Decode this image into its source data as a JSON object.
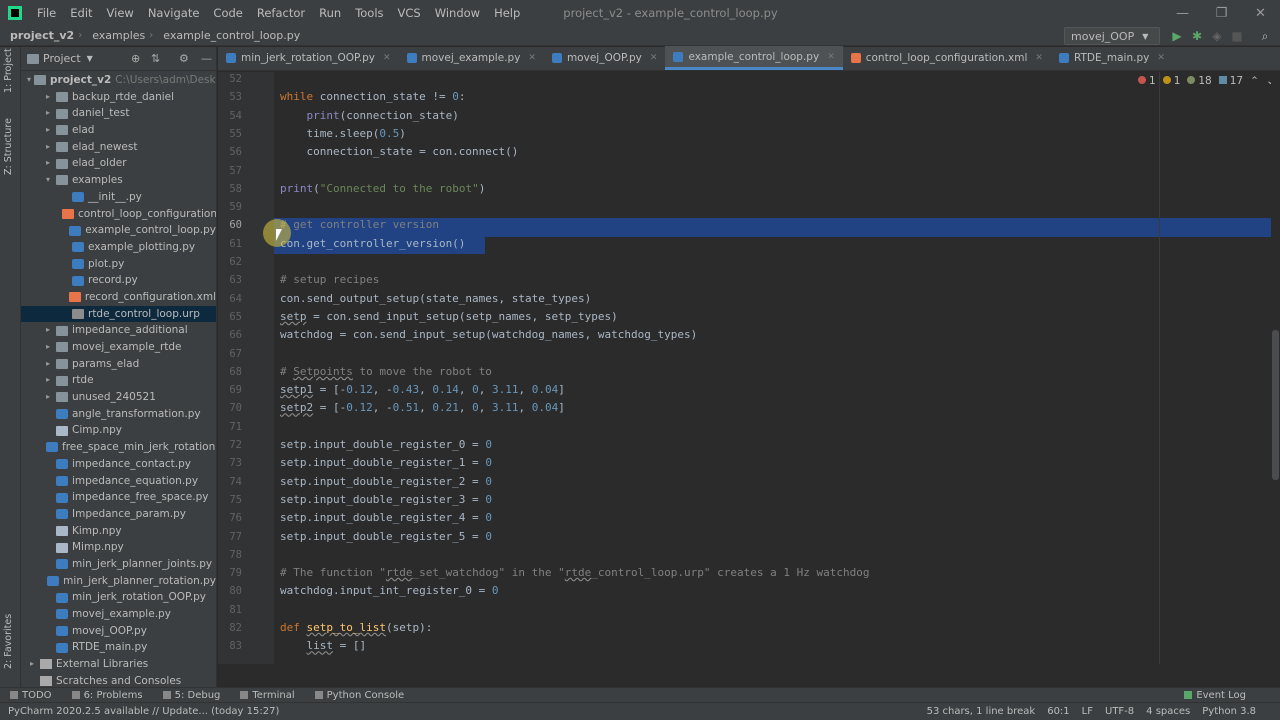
{
  "window": {
    "title": "project_v2 - example_control_loop.py",
    "menu": [
      "File",
      "Edit",
      "View",
      "Navigate",
      "Code",
      "Refactor",
      "Run",
      "Tools",
      "VCS",
      "Window",
      "Help"
    ],
    "controls": [
      "—",
      "❐",
      "✕"
    ]
  },
  "navbar": {
    "crumbs": [
      "project_v2",
      "examples",
      "example_control_loop.py"
    ],
    "run_config": "movej_OOP"
  },
  "left_stripe": {
    "project": "1: Project",
    "structure": "Z: Structure",
    "favorites": "2: Favorites"
  },
  "project_panel": {
    "title": "Project",
    "tree": [
      {
        "label": "project_v2",
        "extra": "C:\\Users\\adm\\Desktop\\p",
        "indent": 0,
        "type": "folder",
        "arrow": "▾",
        "bold": true
      },
      {
        "label": "backup_rtde_daniel",
        "indent": 1,
        "type": "folder",
        "arrow": "▸"
      },
      {
        "label": "daniel_test",
        "indent": 1,
        "type": "folder",
        "arrow": "▸"
      },
      {
        "label": "elad",
        "indent": 1,
        "type": "folder",
        "arrow": "▸"
      },
      {
        "label": "elad_newest",
        "indent": 1,
        "type": "folder",
        "arrow": "▸"
      },
      {
        "label": "elad_older",
        "indent": 1,
        "type": "folder",
        "arrow": "▸"
      },
      {
        "label": "examples",
        "indent": 1,
        "type": "folder",
        "arrow": "▾"
      },
      {
        "label": "__init__.py",
        "indent": 2,
        "type": "py",
        "arrow": ""
      },
      {
        "label": "control_loop_configuration.xml",
        "indent": 2,
        "type": "xml",
        "arrow": ""
      },
      {
        "label": "example_control_loop.py",
        "indent": 2,
        "type": "py",
        "arrow": ""
      },
      {
        "label": "example_plotting.py",
        "indent": 2,
        "type": "py",
        "arrow": ""
      },
      {
        "label": "plot.py",
        "indent": 2,
        "type": "py",
        "arrow": ""
      },
      {
        "label": "record.py",
        "indent": 2,
        "type": "py",
        "arrow": ""
      },
      {
        "label": "record_configuration.xml",
        "indent": 2,
        "type": "xml",
        "arrow": ""
      },
      {
        "label": "rtde_control_loop.urp",
        "indent": 2,
        "type": "urp",
        "arrow": "",
        "selected": true
      },
      {
        "label": "impedance_additional",
        "indent": 1,
        "type": "folder",
        "arrow": "▸"
      },
      {
        "label": "movej_example_rtde",
        "indent": 1,
        "type": "folder",
        "arrow": "▸"
      },
      {
        "label": "params_elad",
        "indent": 1,
        "type": "folder",
        "arrow": "▸"
      },
      {
        "label": "rtde",
        "indent": 1,
        "type": "folder",
        "arrow": "▸"
      },
      {
        "label": "unused_240521",
        "indent": 1,
        "type": "folder",
        "arrow": "▸"
      },
      {
        "label": "angle_transformation.py",
        "indent": 1,
        "type": "py",
        "arrow": ""
      },
      {
        "label": "Cimp.npy",
        "indent": 1,
        "type": "npy",
        "arrow": ""
      },
      {
        "label": "free_space_min_jerk_rotation.py",
        "indent": 1,
        "type": "py",
        "arrow": ""
      },
      {
        "label": "impedance_contact.py",
        "indent": 1,
        "type": "py",
        "arrow": ""
      },
      {
        "label": "impedance_equation.py",
        "indent": 1,
        "type": "py",
        "arrow": ""
      },
      {
        "label": "impedance_free_space.py",
        "indent": 1,
        "type": "py",
        "arrow": ""
      },
      {
        "label": "Impedance_param.py",
        "indent": 1,
        "type": "py",
        "arrow": ""
      },
      {
        "label": "Kimp.npy",
        "indent": 1,
        "type": "npy",
        "arrow": ""
      },
      {
        "label": "Mimp.npy",
        "indent": 1,
        "type": "npy",
        "arrow": ""
      },
      {
        "label": "min_jerk_planner_joints.py",
        "indent": 1,
        "type": "py",
        "arrow": ""
      },
      {
        "label": "min_jerk_planner_rotation.py",
        "indent": 1,
        "type": "py",
        "arrow": ""
      },
      {
        "label": "min_jerk_rotation_OOP.py",
        "indent": 1,
        "type": "py",
        "arrow": ""
      },
      {
        "label": "movej_example.py",
        "indent": 1,
        "type": "py",
        "arrow": ""
      },
      {
        "label": "movej_OOP.py",
        "indent": 1,
        "type": "py",
        "arrow": ""
      },
      {
        "label": "RTDE_main.py",
        "indent": 1,
        "type": "py",
        "arrow": ""
      },
      {
        "label": "External Libraries",
        "indent": 0,
        "type": "lib",
        "arrow": "▸"
      },
      {
        "label": "Scratches and Consoles",
        "indent": 0,
        "type": "lib",
        "arrow": ""
      }
    ]
  },
  "editor_tabs": [
    {
      "label": "min_jerk_rotation_OOP.py",
      "type": "py"
    },
    {
      "label": "movej_example.py",
      "type": "py"
    },
    {
      "label": "movej_OOP.py",
      "type": "py"
    },
    {
      "label": "example_control_loop.py",
      "type": "py",
      "active": true
    },
    {
      "label": "control_loop_configuration.xml",
      "type": "xml"
    },
    {
      "label": "RTDE_main.py",
      "type": "py"
    }
  ],
  "inspections": {
    "errors": "1",
    "warnings": "1",
    "weak": "18",
    "typos": "17"
  },
  "code": {
    "lines": [
      {
        "n": "52",
        "html": ""
      },
      {
        "n": "53",
        "html": "<span class='kw'>while</span> connection_state != <span class='num'>0</span>:"
      },
      {
        "n": "54",
        "html": "    <span class='builtin'>print</span>(connection_state)"
      },
      {
        "n": "55",
        "html": "    time.sleep(<span class='num'>0.5</span>)"
      },
      {
        "n": "56",
        "html": "    connection_state = con.connect()"
      },
      {
        "n": "57",
        "html": ""
      },
      {
        "n": "58",
        "html": "<span class='builtin'>print</span>(<span class='str'>\"Connected to the robot\"</span>)"
      },
      {
        "n": "59",
        "html": ""
      },
      {
        "n": "60",
        "html": "<span class='cmt'># get controller version</span>"
      },
      {
        "n": "61",
        "html": "con.get_controller_version()"
      },
      {
        "n": "62",
        "html": ""
      },
      {
        "n": "63",
        "html": "<span class='cmt'># setup recipes</span>"
      },
      {
        "n": "64",
        "html": "con.send_output_setup(state_names, state_types)"
      },
      {
        "n": "65",
        "html": "<span class='warn-underline'>setp</span> = con.send_input_setup(setp_names, setp_types)"
      },
      {
        "n": "66",
        "html": "watchdog = con.send_input_setup(watchdog_names, watchdog_types)"
      },
      {
        "n": "67",
        "html": ""
      },
      {
        "n": "68",
        "html": "<span class='cmt'># <span class='warn-underline'>Setpoints</span> to move the robot to</span>"
      },
      {
        "n": "69",
        "html": "<span class='warn-underline'>setp1</span> = [-<span class='num'>0.12</span>, -<span class='num'>0.43</span>, <span class='num'>0.14</span>, <span class='num'>0</span>, <span class='num'>3.11</span>, <span class='num'>0.04</span>]"
      },
      {
        "n": "70",
        "html": "<span class='warn-underline'>setp2</span> = [-<span class='num'>0.12</span>, -<span class='num'>0.51</span>, <span class='num'>0.21</span>, <span class='num'>0</span>, <span class='num'>3.11</span>, <span class='num'>0.04</span>]"
      },
      {
        "n": "71",
        "html": ""
      },
      {
        "n": "72",
        "html": "setp.input_double_register_0 = <span class='num'>0</span>"
      },
      {
        "n": "73",
        "html": "setp.input_double_register_1 = <span class='num'>0</span>"
      },
      {
        "n": "74",
        "html": "setp.input_double_register_2 = <span class='num'>0</span>"
      },
      {
        "n": "75",
        "html": "setp.input_double_register_3 = <span class='num'>0</span>"
      },
      {
        "n": "76",
        "html": "setp.input_double_register_4 = <span class='num'>0</span>"
      },
      {
        "n": "77",
        "html": "setp.input_double_register_5 = <span class='num'>0</span>"
      },
      {
        "n": "78",
        "html": ""
      },
      {
        "n": "79",
        "html": "<span class='cmt'># The function \"<span class='warn-underline'>rtde</span>_set_watchdog\" in the \"<span class='warn-underline'>rtde</span>_control_loop.urp\" creates a 1 Hz watchdog</span>"
      },
      {
        "n": "80",
        "html": "watchdog.input_int_register_0 = <span class='num'>0</span>"
      },
      {
        "n": "81",
        "html": ""
      },
      {
        "n": "82",
        "html": "<span class='kw'>def</span> <span class='fn warn-underline'>setp_to_list</span>(setp):"
      },
      {
        "n": "83",
        "html": "    <span class='warn-underline'>list</span> = []"
      }
    ]
  },
  "bottom_tools": [
    "TODO",
    "6: Problems",
    "5: Debug",
    "Terminal",
    "Python Console"
  ],
  "event_log": "Event Log",
  "status": {
    "message": "PyCharm 2020.2.5 available // Update... (today 15:27)",
    "right": [
      "53 chars, 1 line break",
      "60:1",
      "LF",
      "UTF-8",
      "4 spaces",
      "Python 3.8"
    ]
  },
  "colors": {
    "accent": "#4a88c7",
    "selection": "#214283",
    "background": "#2b2b2b"
  }
}
